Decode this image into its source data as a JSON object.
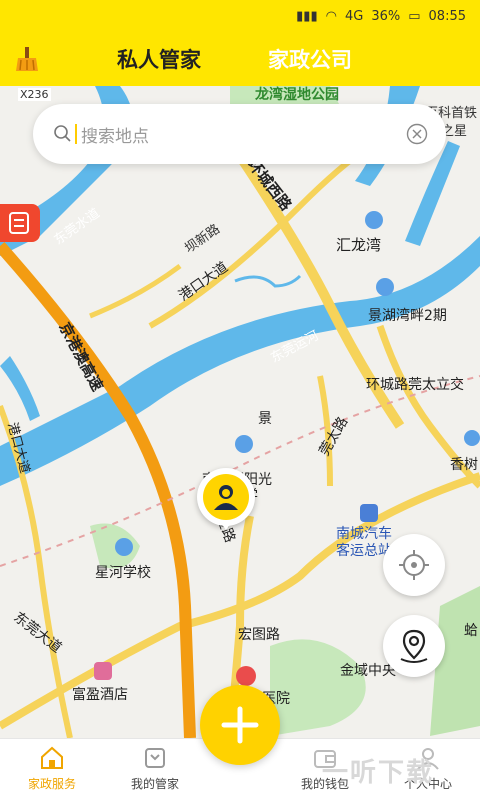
{
  "status_bar": {
    "network": "4G",
    "battery": "36%",
    "time": "08:55"
  },
  "header": {
    "tab_personal": "私人管家",
    "tab_company": "家政公司"
  },
  "search": {
    "placeholder": "搜索地点"
  },
  "map": {
    "road_labels": [
      "X236",
      "环城西路",
      "东莞水道",
      "坝新路",
      "汇龙湾",
      "港口大道",
      "景湖湾畔2期",
      "东莞运河",
      "京港澳高速",
      "环城路莞太立交",
      "港口大道",
      "莞太路",
      "香树",
      "黄金路",
      "南城区阳光第五小学",
      "南城汽车客运总站",
      "星河学校",
      "东莞大道",
      "宏图路",
      "富盈酒店",
      "金域中央",
      "医院",
      "龙湾湿地公园",
      "百科首铁",
      "汇之星",
      "景",
      "蛤"
    ]
  },
  "bottom_nav": {
    "items": [
      {
        "label": "家政服务"
      },
      {
        "label": "我的管家"
      },
      {
        "label": "我的钱包"
      },
      {
        "label": "个人中心"
      }
    ]
  },
  "watermark": "一听下载",
  "colors": {
    "brand_yellow": "#ffe600",
    "active_orange": "#f0a500",
    "highway_orange": "#f39c12"
  }
}
